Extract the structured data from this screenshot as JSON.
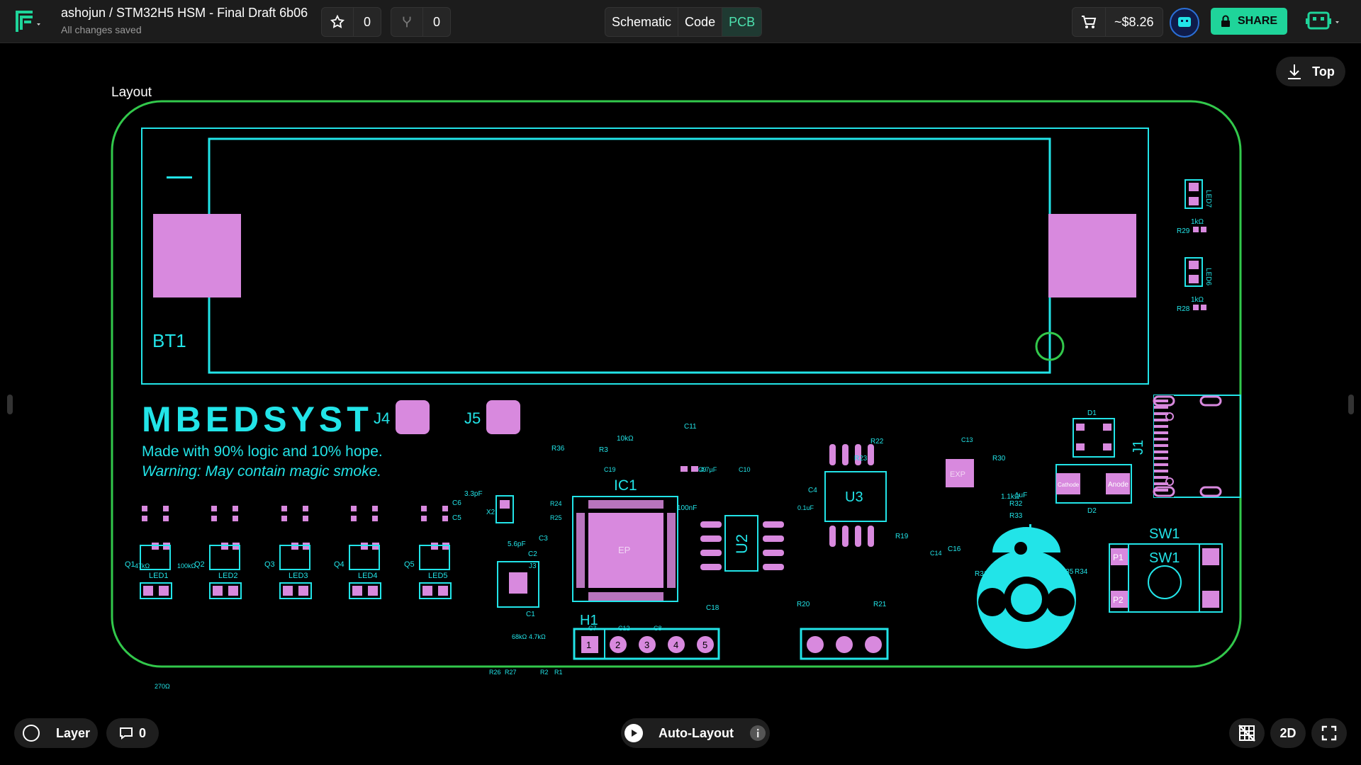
{
  "project": {
    "title": "ashojun / STM32H5 HSM - Final Draft 6b06",
    "status": "All changes saved"
  },
  "toolbar": {
    "stars": "0",
    "forks": "0"
  },
  "view_tabs": [
    "Schematic",
    "Code",
    "PCB"
  ],
  "active_view": "PCB",
  "cart": {
    "price": "~$8.26"
  },
  "share_label": "SHARE",
  "canvas": {
    "label": "Layout",
    "top_button": "Top"
  },
  "bottom": {
    "layer_label": "Layer",
    "comments_count": "0",
    "autolayout_label": "Auto-Layout",
    "view_mode": "2D"
  },
  "colors": {
    "board_outline": "#32c84b",
    "silkscreen": "#22e4e8",
    "pads": "#d889de",
    "accent": "#1fd49a"
  },
  "board": {
    "battery_ref": "BT1",
    "brand": "MBEDSYST",
    "tagline": "Made with 90% logic and 10% hope.",
    "warning": "Warning: May contain magic smoke.",
    "connectors": [
      "J4",
      "J5",
      "J1"
    ],
    "ic1": "IC1",
    "ic1_pad": "EP",
    "u2": "U2",
    "u3": "U3",
    "ic2_pad": "EXP",
    "sw1": "SW1",
    "h1": "H1",
    "h1_pins": [
      "1",
      "2",
      "3",
      "4",
      "5"
    ],
    "transistors": [
      "Q1",
      "Q2",
      "Q3",
      "Q4",
      "Q5"
    ],
    "leds": [
      "LED1",
      "LED2",
      "LED3",
      "LED4",
      "LED5"
    ],
    "led_right": [
      "LED7",
      "LED6"
    ],
    "res_right": [
      "R29",
      "R28"
    ],
    "res_right_val": "1kΩ",
    "d1": "D1",
    "d2": "D2",
    "d2_pads": [
      "Cathode",
      "Anode"
    ],
    "x2": "X2",
    "j3": "J3",
    "sw_pins": [
      "P1",
      "P2"
    ],
    "caps_misc": [
      "C11",
      "C18",
      "C16",
      "C9",
      "C6",
      "C5",
      "C2",
      "C1",
      "C3",
      "C4",
      "C13",
      "C14",
      "C15",
      "C10",
      "C7",
      "C8",
      "C12",
      "C19"
    ],
    "values_misc": [
      "10kΩ",
      "4.7µF",
      "100nF",
      "3.3pF",
      "5.6pF",
      "0.1uF",
      "1uF",
      "1.1kΩ",
      "270Ω",
      "47kΩ",
      "68kΩ",
      "4.7kΩ",
      "100kΩ"
    ],
    "res_misc": [
      "R36",
      "R3",
      "R22",
      "R23",
      "R30",
      "R32",
      "R33",
      "R31",
      "R35",
      "R34",
      "R19",
      "R20",
      "R21",
      "R24",
      "R25",
      "R26",
      "R27",
      "R2",
      "R1"
    ]
  }
}
